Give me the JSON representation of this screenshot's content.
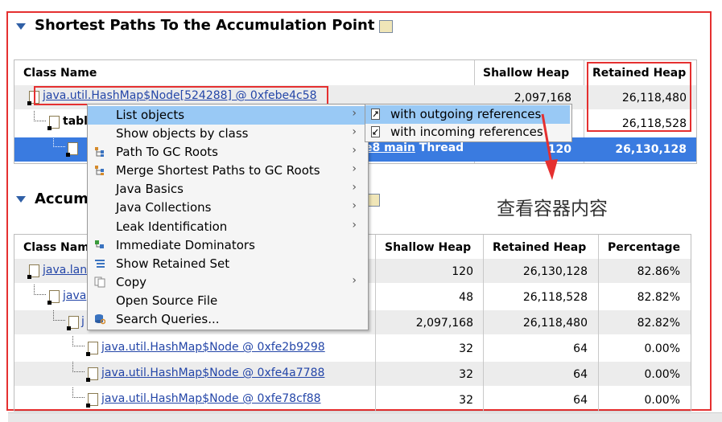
{
  "section1": {
    "title": "Shortest Paths To the Accumulation Point",
    "headers": {
      "class_name": "Class Name",
      "shallow": "Shallow Heap",
      "retained": "Retained Heap"
    },
    "rows": [
      {
        "name": "java.util.HashMap$Node[524288] @ 0xfebe4c58",
        "shallow": "2,097,168",
        "retained": "26,118,480"
      },
      {
        "name": "tabl",
        "shallow": "",
        "retained": "26,118,528"
      },
      {
        "name_partial": "e8 main",
        "thread_label": "Thread",
        "shallow": "120",
        "retained": "26,130,128"
      }
    ]
  },
  "section2": {
    "title_partial": "Accum",
    "headers": {
      "class_name": "Class Nam",
      "shallow": "Shallow Heap",
      "retained": "Retained Heap",
      "percentage": "Percentage"
    },
    "rows": [
      {
        "name": "java.lan",
        "shallow": "120",
        "retained": "26,130,128",
        "pct": "82.86%"
      },
      {
        "name": "java",
        "shallow": "48",
        "retained": "26,118,528",
        "pct": "82.82%"
      },
      {
        "name": "j",
        "shallow": "2,097,168",
        "retained": "26,118,480",
        "pct": "82.82%"
      },
      {
        "name": "java.util.HashMap$Node @ 0xfe2b9298",
        "shallow": "32",
        "retained": "64",
        "pct": "0.00%"
      },
      {
        "name": "java.util.HashMap$Node @ 0xfe4a7788",
        "shallow": "32",
        "retained": "64",
        "pct": "0.00%"
      },
      {
        "name": "java.util.HashMap$Node @ 0xfe78cf88",
        "shallow": "32",
        "retained": "64",
        "pct": "0.00%"
      }
    ]
  },
  "context_menu": {
    "items": [
      {
        "label": "List objects",
        "has_submenu": true,
        "icon": "",
        "highlighted": true
      },
      {
        "label": "Show objects by class",
        "has_submenu": true,
        "icon": ""
      },
      {
        "label": "Path To GC Roots",
        "has_submenu": true,
        "icon": "tree-path-icon"
      },
      {
        "label": "Merge Shortest Paths to GC Roots",
        "has_submenu": true,
        "icon": "merge-paths-icon"
      },
      {
        "label": "Java Basics",
        "has_submenu": true,
        "icon": ""
      },
      {
        "label": "Java Collections",
        "has_submenu": true,
        "icon": ""
      },
      {
        "label": "Leak Identification",
        "has_submenu": true,
        "icon": ""
      },
      {
        "label": "Immediate Dominators",
        "has_submenu": false,
        "icon": "dominators-icon"
      },
      {
        "label": "Show Retained Set",
        "has_submenu": false,
        "icon": "retained-set-icon"
      },
      {
        "label": "Copy",
        "has_submenu": true,
        "icon": "copy-icon"
      },
      {
        "label": "Open Source File",
        "has_submenu": false,
        "icon": ""
      },
      {
        "label": "Search Queries...",
        "has_submenu": false,
        "icon": "search-queries-icon"
      }
    ]
  },
  "submenu": {
    "items": [
      {
        "label": "with outgoing references",
        "highlighted": true
      },
      {
        "label": "with incoming references",
        "highlighted": false
      }
    ]
  },
  "annotation": {
    "text": "查看容器内容",
    "color": "#e53030"
  },
  "colors": {
    "selection": "#3a7be0",
    "menu_highlight": "#99c9f5",
    "accent": "#2f5fa6"
  }
}
